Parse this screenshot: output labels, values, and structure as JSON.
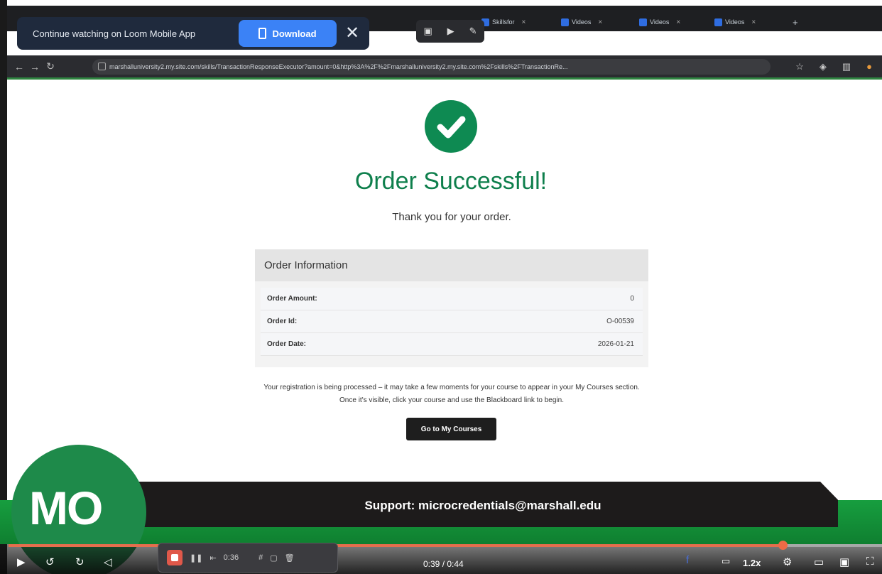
{
  "loom": {
    "banner_text": "Continue watching on Loom Mobile App",
    "download_label": "Download",
    "close_glyph": "✕"
  },
  "browser": {
    "tabs": [
      {
        "label": "Skillsfor"
      },
      {
        "label": "Videos"
      },
      {
        "label": "Videos"
      },
      {
        "label": "Videos"
      }
    ],
    "url": "marshalluniversity2.my.site.com/skills/TransactionResponseExecutor?amount=0&http%3A%2F%2Fmarshalluniversity2.my.site.com%2Fskills%2FTransactionRe..."
  },
  "page": {
    "title": "Order Successful!",
    "subtitle": "Thank you for your order.",
    "order_info": {
      "heading": "Order Information",
      "rows": [
        {
          "label": "Order Amount:",
          "value": "0"
        },
        {
          "label": "Order Id:",
          "value": "O-00539"
        },
        {
          "label": "Order Date:",
          "value": "2026-01-21"
        }
      ]
    },
    "registration_text": "Your registration is being processed – it may take a few moments for your course to appear in your My Courses section. Once it's visible, click your course and use the Blackboard link to begin.",
    "go_button": "Go to My Courses",
    "success_color": "#0e8a52"
  },
  "footer": {
    "support_text": "Support: microcredentials@marshall.edu"
  },
  "avatar": {
    "initials": "MO"
  },
  "player": {
    "time": "0:39 / 0:44",
    "speed": "1.2x",
    "progress": 0.886,
    "recording_timer": "0:36"
  }
}
